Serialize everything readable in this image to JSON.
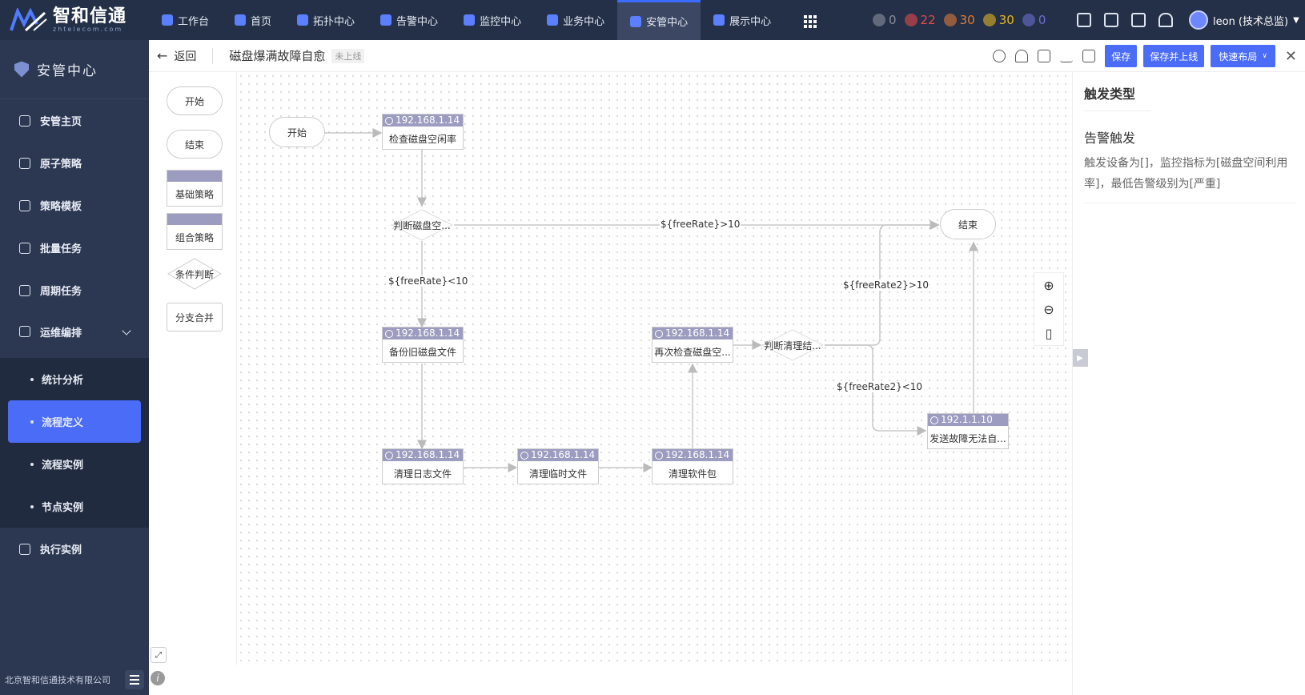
{
  "brand": {
    "name": "智和信通",
    "sub": "zhtelecom.com"
  },
  "nav": [
    {
      "label": "工作台",
      "icon": "home-icon",
      "active": false
    },
    {
      "label": "首页",
      "icon": "home-icon",
      "active": false
    },
    {
      "label": "拓扑中心",
      "icon": "topology-icon",
      "active": false
    },
    {
      "label": "告警中心",
      "icon": "alarm-icon",
      "active": false
    },
    {
      "label": "监控中心",
      "icon": "monitor-icon",
      "active": false
    },
    {
      "label": "业务中心",
      "icon": "business-icon",
      "active": false
    },
    {
      "label": "安管中心",
      "icon": "shield-icon",
      "active": true
    },
    {
      "label": "展示中心",
      "icon": "display-icon",
      "active": false
    }
  ],
  "status_counts": [
    {
      "value": "0",
      "color": "#8a8f9c",
      "icon": "close-circle-icon"
    },
    {
      "value": "22",
      "color": "#e24a4a",
      "icon": "lightning-icon"
    },
    {
      "value": "30",
      "color": "#e07a3a",
      "icon": "exclamation-icon"
    },
    {
      "value": "30",
      "color": "#e6b422",
      "icon": "bell-icon"
    },
    {
      "value": "0",
      "color": "#6b6fd1",
      "icon": "question-icon"
    }
  ],
  "user": {
    "name": "leon (技术总监)"
  },
  "sidebar": {
    "title": "安管中心",
    "items": [
      {
        "label": "安管主页",
        "icon": "home-icon"
      },
      {
        "label": "原子策略",
        "icon": "gear-icon"
      },
      {
        "label": "策略模板",
        "icon": "template-icon"
      },
      {
        "label": "批量任务",
        "icon": "slider-icon"
      },
      {
        "label": "周期任务",
        "icon": "clock-icon"
      },
      {
        "label": "运维编排",
        "icon": "orchestration-icon"
      }
    ],
    "subitems": [
      {
        "label": "统计分析",
        "active": false
      },
      {
        "label": "流程定义",
        "active": true
      },
      {
        "label": "流程实例",
        "active": false
      },
      {
        "label": "节点实例",
        "active": false
      }
    ],
    "last_item": {
      "label": "执行实例",
      "icon": "execute-icon"
    },
    "footer": "北京智和信通技术有限公司"
  },
  "toolbar": {
    "back": "返回",
    "title": "磁盘爆满故障自愈",
    "state": "未上线",
    "save": "保存",
    "save_publish": "保存并上线",
    "quick_layout": "快速布局"
  },
  "palette": {
    "start": "开始",
    "end": "结束",
    "basic": "基础策略",
    "combo": "组合策略",
    "condition": "条件判断",
    "merge": "分支合并"
  },
  "flow": {
    "start": "开始",
    "end": "结束",
    "n1": {
      "ip": "192.168.1.14",
      "label": "检查磁盘空闲率"
    },
    "d1": "判断磁盘空...",
    "n2": {
      "ip": "192.168.1.14",
      "label": "备份旧磁盘文件"
    },
    "n3": {
      "ip": "192.168.1.14",
      "label": "清理日志文件"
    },
    "n4": {
      "ip": "192.168.1.14",
      "label": "清理临时文件"
    },
    "n5": {
      "ip": "192.168.1.14",
      "label": "清理软件包"
    },
    "n6": {
      "ip": "192.168.1.14",
      "label": "再次检查磁盘空..."
    },
    "d2": "判断清理结...",
    "n7": {
      "ip": "192.1.1.10",
      "label": "发送故障无法自..."
    },
    "e1": "${freeRate}>10",
    "e2": "${freeRate}<10",
    "e3": "${freeRate2}>10",
    "e4": "${freeRate2}<10"
  },
  "panel": {
    "title": "触发类型",
    "subtitle": "告警触发",
    "desc": "触发设备为[]，监控指标为[磁盘空间利用率]，最低告警级别为[严重]"
  }
}
